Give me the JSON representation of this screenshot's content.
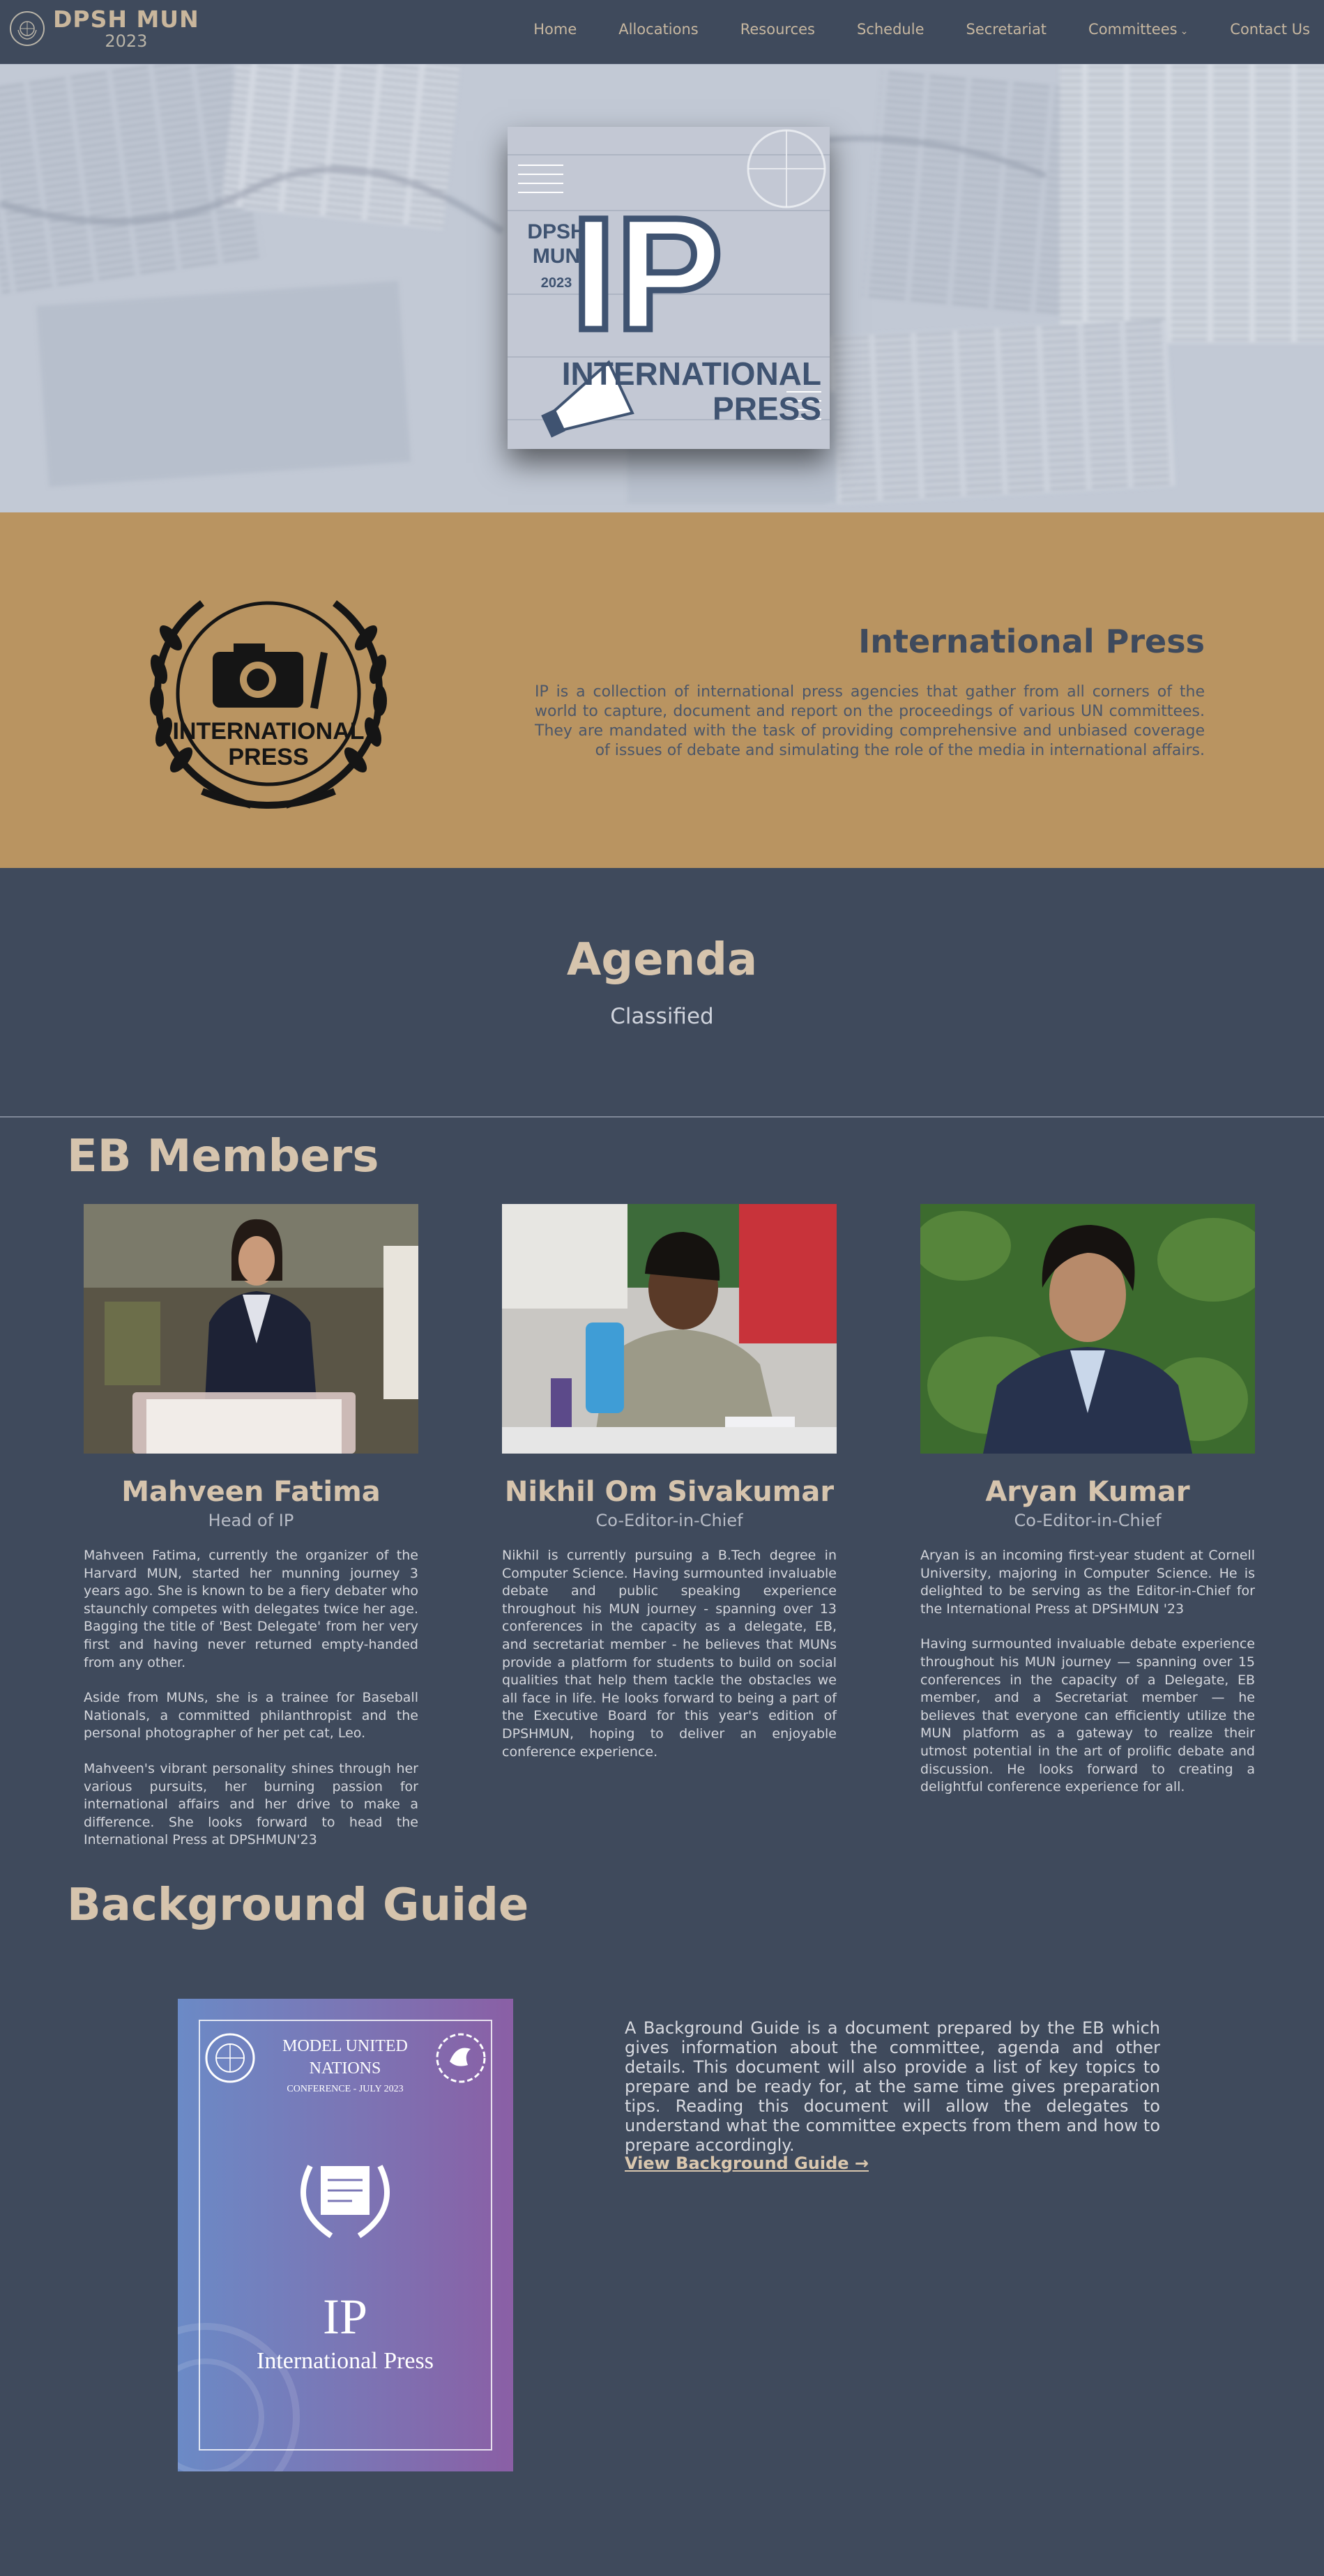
{
  "nav": {
    "brand_title": "DPSH MUN",
    "brand_year": "2023",
    "links": [
      "Home",
      "Allocations",
      "Resources",
      "Schedule",
      "Secretariat",
      "Committees",
      "Contact Us"
    ]
  },
  "hero": {
    "card": {
      "school": "DPSH",
      "mun": "MUN",
      "year": "2023",
      "abbr": "IP",
      "name_line1": "INTERNATIONAL",
      "name_line2": "PRESS"
    }
  },
  "ip": {
    "emblem_line1": "INTERNATIONAL",
    "emblem_line2": "PRESS",
    "title": "International Press",
    "description": "IP is a collection of international press agencies that gather from all corners of the world to capture, document and report on the proceedings of various UN committees. They are mandated with the task of providing comprehensive and unbiased coverage of issues of debate and simulating the role of the media in international affairs."
  },
  "agenda": {
    "title": "Agenda",
    "value": "Classified"
  },
  "eb": {
    "title": "EB Members",
    "members": [
      {
        "name": "Mahveen Fatima",
        "role": "Head of IP",
        "bio": [
          "Mahveen Fatima, currently the organizer of the Harvard MUN, started her munning journey 3 years ago. She is known to be a fiery debater who staunchly competes with delegates twice her age. Bagging the title of 'Best Delegate' from her very first and having never returned empty-handed from any other.",
          "Aside from MUNs, she is a trainee for Baseball Nationals, a committed philanthropist and the personal photographer of her pet cat, Leo.",
          "Mahveen's vibrant personality shines through her various pursuits, her burning passion for international affairs and her drive to make a difference. She looks forward to head the International Press at DPSHMUN'23"
        ]
      },
      {
        "name": "Nikhil Om Sivakumar",
        "role": "Co-Editor-in-Chief",
        "bio": [
          "Nikhil is currently pursuing a B.Tech degree in Computer Science. Having surmounted invaluable debate and public speaking experience throughout his MUN journey - spanning over 13 conferences in the capacity as a delegate, EB, and secretariat member - he believes that MUNs provide a platform for students to build on social qualities that help them tackle the obstacles we all face in life. He looks forward to being a part of the Executive Board for this year's edition of DPSHMUN, hoping to deliver an enjoyable conference experience."
        ]
      },
      {
        "name": "Aryan Kumar",
        "role": "Co-Editor-in-Chief",
        "bio": [
          "Aryan is an incoming first-year student at Cornell University, majoring in Computer Science. He is delighted to be serving as the Editor-in-Chief for the International Press at DPSHMUN '23",
          "Having surmounted invaluable debate experience throughout his MUN journey — spanning over 15 conferences in the capacity of a Delegate, EB member, and a Secretariat member — he believes that everyone can efficiently utilize the MUN platform as a gateway to realize their utmost potential in the art of prolific debate and discussion. He looks forward to creating a delightful conference experience for all."
        ]
      }
    ]
  },
  "bg": {
    "title": "Background Guide",
    "cover": {
      "line1": "MODEL UNITED",
      "line2": "NATIONS",
      "line3": "CONFERENCE - JULY 2023",
      "abbr": "IP",
      "name": "International Press"
    },
    "description": "A Background Guide is a document prepared by the EB which gives information about the committee, agenda and other details. This document will also provide a list of key topics to prepare and be ready for, at the same time gives preparation tips. Reading this document will allow the delegates to understand what the committee expects from them and how to prepare accordingly.",
    "link": "View Background Guide →"
  }
}
